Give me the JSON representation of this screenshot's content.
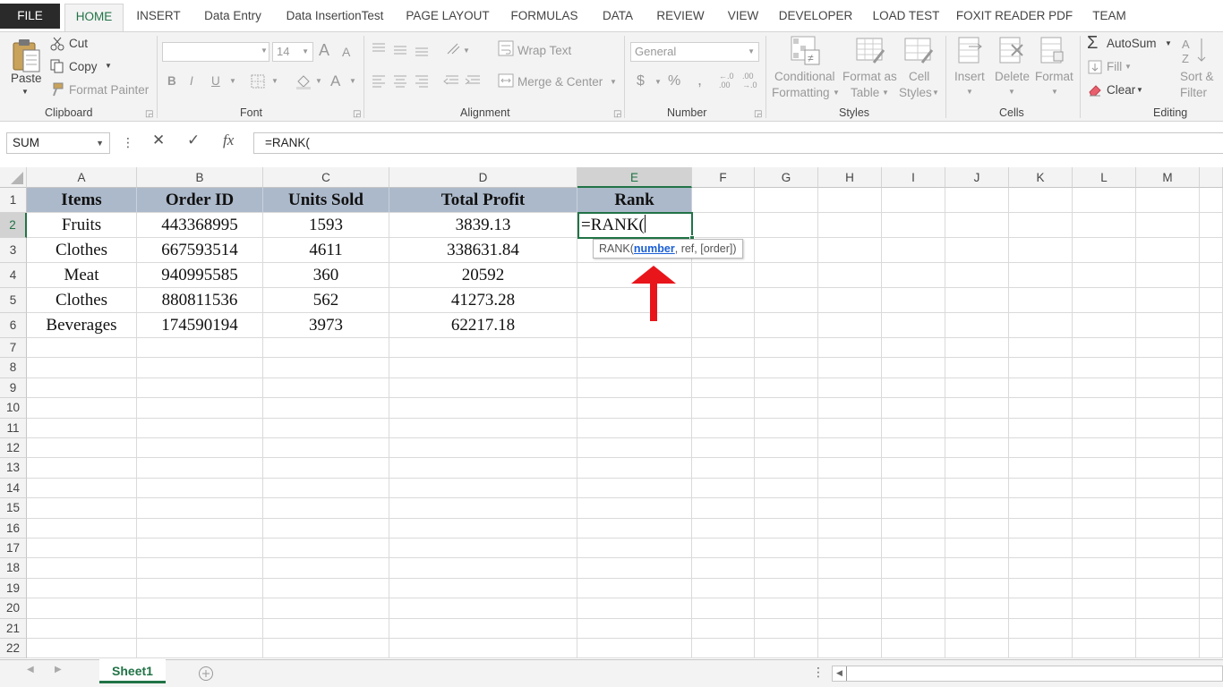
{
  "ribbon_tabs": [
    "FILE",
    "HOME",
    "INSERT",
    "Data Entry",
    "Data InsertionTest",
    "PAGE LAYOUT",
    "FORMULAS",
    "DATA",
    "REVIEW",
    "VIEW",
    "DEVELOPER",
    "LOAD TEST",
    "FOXIT READER PDF",
    "TEAM"
  ],
  "active_tab": "HOME",
  "clipboard": {
    "paste": "Paste",
    "cut": "Cut",
    "copy": "Copy",
    "format_painter": "Format Painter",
    "label": "Clipboard"
  },
  "font": {
    "name": "",
    "size": "14",
    "bold": "B",
    "italic": "I",
    "underline": "U",
    "grow": "A",
    "shrink": "A",
    "font_color": "A",
    "label": "Font"
  },
  "alignment": {
    "wrap_text": "Wrap Text",
    "merge_center": "Merge & Center",
    "label": "Alignment"
  },
  "number": {
    "format": "General",
    "currency": "$",
    "percent": "%",
    "comma": ",",
    "inc_dec": "←.0 .00",
    "dec_dec": ".00 →.0",
    "label": "Number"
  },
  "styles": {
    "conditional": [
      "Conditional",
      "Formatting"
    ],
    "format_table": [
      "Format as",
      "Table"
    ],
    "cell_styles": [
      "Cell",
      "Styles"
    ],
    "label": "Styles"
  },
  "cells": {
    "insert": "Insert",
    "delete": "Delete",
    "format": "Format",
    "label": "Cells"
  },
  "editing": {
    "autosum": "AutoSum",
    "fill": "Fill",
    "clear": "Clear",
    "sort_filter": [
      "Sort &",
      "Filter"
    ],
    "label": "Editing"
  },
  "formula_bar": {
    "name_box": "SUM",
    "formula": "=RANK(",
    "cancel": "✕",
    "enter": "✓",
    "fx": "fx"
  },
  "columns": [
    "A",
    "B",
    "C",
    "D",
    "E",
    "F",
    "G",
    "H",
    "I",
    "J",
    "K",
    "L",
    "M"
  ],
  "selected_column": "E",
  "selected_row": 2,
  "rows": [
    "1",
    "2",
    "3",
    "4",
    "5",
    "6",
    "7",
    "8",
    "9",
    "10",
    "11",
    "12",
    "13",
    "14",
    "15",
    "16",
    "17",
    "18",
    "19",
    "20",
    "21",
    "22"
  ],
  "table": {
    "headers": [
      "Items",
      "Order ID",
      "Units Sold",
      "Total Profit",
      "Rank"
    ],
    "rows": [
      [
        "Fruits",
        "443368995",
        "1593",
        "3839.13"
      ],
      [
        "Clothes",
        "667593514",
        "4611",
        "338631.84"
      ],
      [
        "Meat",
        "940995585",
        "360",
        "20592"
      ],
      [
        "Clothes",
        "880811536",
        "562",
        "41273.28"
      ],
      [
        "Beverages",
        "174590194",
        "3973",
        "62217.18"
      ]
    ]
  },
  "active_cell": {
    "ref": "E2",
    "value": "=RANK("
  },
  "tooltip": {
    "func": "RANK(",
    "arg": "number",
    "rest": ", ref, [order])"
  },
  "sheets": [
    "Sheet1"
  ],
  "colors": {
    "accent": "#217346",
    "header_fill": "#acb9ca",
    "arrow": "#e8151b"
  }
}
